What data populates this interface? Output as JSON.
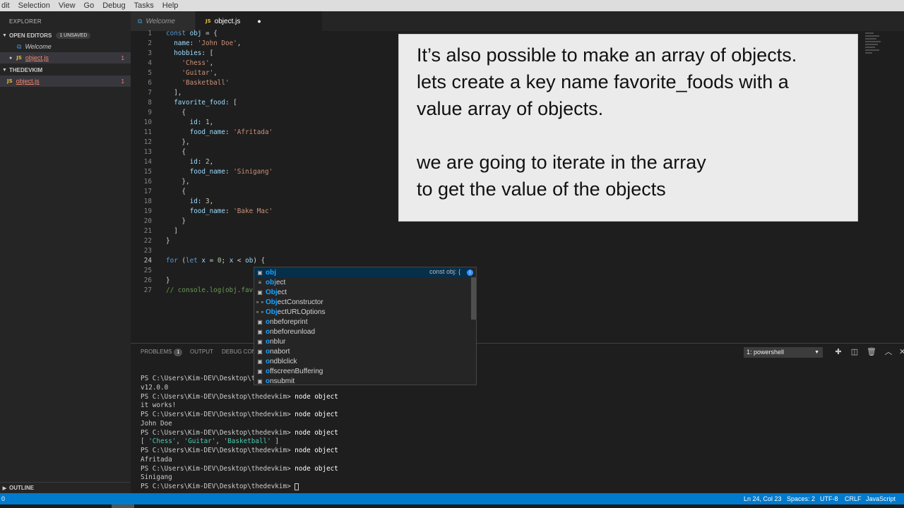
{
  "menubar": {
    "items": [
      "dit",
      "Selection",
      "View",
      "Go",
      "Debug",
      "Tasks",
      "Help"
    ]
  },
  "sidebar": {
    "title": "EXPLORER",
    "open_editors": {
      "label": "OPEN EDITORS",
      "badge": "1 UNSAVED",
      "icon": "chevron-down-icon"
    },
    "open_files": [
      {
        "name": "Welcome",
        "icon": "vscode-icon"
      },
      {
        "name": "object.js",
        "icon": "js-icon",
        "count": "1"
      }
    ],
    "folder": {
      "label": "THEDEVKIM",
      "icon": "chevron-down-icon"
    },
    "folder_files": [
      {
        "name": "object.js",
        "icon": "js-icon",
        "count": "1"
      }
    ],
    "outline": {
      "label": "OUTLINE",
      "icon": "chevron-right-icon"
    }
  },
  "tabs": [
    {
      "label": "Welcome",
      "icon": "vscode-icon"
    },
    {
      "label": "object.js",
      "icon": "js-icon",
      "dirty": "●"
    }
  ],
  "editor": {
    "lines": [
      {
        "n": "1",
        "html": "<span class='k'>const</span> <span class='p'>obj</span> <span class='t'>= {</span>"
      },
      {
        "n": "2",
        "html": "  <span class='p'>name</span><span class='t'>:</span> <span class='s'>'John Doe'</span><span class='t'>,</span>"
      },
      {
        "n": "3",
        "html": "  <span class='p'>hobbies</span><span class='t'>: [</span>"
      },
      {
        "n": "4",
        "html": "    <span class='s'>'Chess'</span><span class='t'>,</span>"
      },
      {
        "n": "5",
        "html": "    <span class='s'>'Guitar'</span><span class='t'>,</span>"
      },
      {
        "n": "6",
        "html": "    <span class='s'>'Basketball'</span>"
      },
      {
        "n": "7",
        "html": "  <span class='t'>],</span>"
      },
      {
        "n": "8",
        "html": "  <span class='p'>favorite_food</span><span class='t'>: [</span>"
      },
      {
        "n": "9",
        "html": "    <span class='t'>{</span>"
      },
      {
        "n": "10",
        "html": "      <span class='p'>id</span><span class='t'>:</span> <span class='n'>1</span><span class='t'>,</span>"
      },
      {
        "n": "11",
        "html": "      <span class='p'>food_name</span><span class='t'>:</span> <span class='s'>'Afritada'</span>"
      },
      {
        "n": "12",
        "html": "    <span class='t'>},</span>"
      },
      {
        "n": "13",
        "html": "    <span class='t'>{</span>"
      },
      {
        "n": "14",
        "html": "      <span class='p'>id</span><span class='t'>:</span> <span class='n'>2</span><span class='t'>,</span>"
      },
      {
        "n": "15",
        "html": "      <span class='p'>food_name</span><span class='t'>:</span> <span class='s'>'Sinigang'</span>"
      },
      {
        "n": "16",
        "html": "    <span class='t'>},</span>"
      },
      {
        "n": "17",
        "html": "    <span class='t'>{</span>"
      },
      {
        "n": "18",
        "html": "      <span class='p'>id</span><span class='t'>:</span> <span class='n'>3</span><span class='t'>,</span>"
      },
      {
        "n": "19",
        "html": "      <span class='p'>food_name</span><span class='t'>:</span> <span class='s'>'Bake Mac'</span>"
      },
      {
        "n": "20",
        "html": "    <span class='t'>}</span>"
      },
      {
        "n": "21",
        "html": "  <span class='t'>]</span>"
      },
      {
        "n": "22",
        "html": "<span class='t'>}</span>"
      },
      {
        "n": "23",
        "html": ""
      },
      {
        "n": "24",
        "html": "<span class='k'>for</span> <span class='t'>(</span><span class='k'>let</span> <span class='p'>x</span> <span class='t'>=</span> <span class='n'>0</span><span class='t'>;</span> <span class='p'>x</span> <span class='t'>&lt;</span> <span class='p'>ob</span><span class='t'>)</span> <span class='t'>{</span>",
        "active": true
      },
      {
        "n": "25",
        "html": ""
      },
      {
        "n": "26",
        "html": "<span class='t'>}</span>"
      },
      {
        "n": "27",
        "html": "<span class='c'>// console.log(obj.fav</span>"
      }
    ]
  },
  "callout": {
    "para1": [
      "It’s also possible to make an array of objects.",
      "lets create a key name favorite_foods with a",
      "value array of objects."
    ],
    "para2": [
      "we are going to iterate in the array",
      "to get the value of the objects"
    ]
  },
  "suggest": {
    "detail": "const obj: {",
    "items": [
      {
        "icon": "▣",
        "pre": "",
        "hl": "obj",
        "post": ""
      },
      {
        "icon": "≡",
        "pre": "",
        "hl": "obj",
        "post": "ect"
      },
      {
        "icon": "▣",
        "pre": "",
        "hl": "Obj",
        "post": "ect"
      },
      {
        "icon": "⚬⚬",
        "pre": "",
        "hl": "Obj",
        "post": "ectConstructor"
      },
      {
        "icon": "⚬⚬",
        "pre": "",
        "hl": "Obj",
        "post": "ectURLOptions"
      },
      {
        "icon": "▣",
        "pre": "",
        "hl": "o",
        "post": "nbeforeprint",
        "hl2": "b"
      },
      {
        "icon": "▣",
        "pre": "",
        "hl": "o",
        "post": "nbeforeunload"
      },
      {
        "icon": "▣",
        "pre": "",
        "hl": "o",
        "post": "nblur"
      },
      {
        "icon": "▣",
        "pre": "",
        "hl": "o",
        "post": "nabort"
      },
      {
        "icon": "▣",
        "pre": "",
        "hl": "o",
        "post": "ndblclick"
      },
      {
        "icon": "▣",
        "pre": "",
        "hl": "o",
        "post": "ffscreenBuffering"
      },
      {
        "icon": "▣",
        "pre": "",
        "hl": "o",
        "post": "nsubmit"
      }
    ]
  },
  "panel": {
    "tabs": [
      {
        "label": "PROBLEMS",
        "badge": "1"
      },
      {
        "label": "OUTPUT"
      },
      {
        "label": "DEBUG CON"
      }
    ],
    "terminal_select": "1: powershell",
    "icons": [
      "plus-icon",
      "split-icon",
      "trash-icon",
      "chevron-up-icon"
    ]
  },
  "terminal": {
    "lines": [
      {
        "prompt": "PS C:\\Users\\Kim-DEV\\Desktop\\t",
        "cmd": ""
      },
      {
        "text": "v12.0.0"
      },
      {
        "prompt": "PS C:\\Users\\Kim-DEV\\Desktop\\thedevkim> ",
        "cmd": "node object"
      },
      {
        "text": "it works!"
      },
      {
        "prompt": "PS C:\\Users\\Kim-DEV\\Desktop\\thedevkim> ",
        "cmd": "node object"
      },
      {
        "text": "John Doe"
      },
      {
        "prompt": "PS C:\\Users\\Kim-DEV\\Desktop\\thedevkim> ",
        "cmd": "node object"
      },
      {
        "array": [
          "'Chess'",
          "'Guitar'",
          "'Basketball'"
        ]
      },
      {
        "prompt": "PS C:\\Users\\Kim-DEV\\Desktop\\thedevkim> ",
        "cmd": "node object"
      },
      {
        "text": "Afritada"
      },
      {
        "prompt": "PS C:\\Users\\Kim-DEV\\Desktop\\thedevkim> ",
        "cmd": "node object"
      },
      {
        "text": "Sinigang"
      },
      {
        "prompt": "PS C:\\Users\\Kim-DEV\\Desktop\\thedevkim> ",
        "cmd": "",
        "cursor": true
      }
    ]
  },
  "statusbar": {
    "left": "0",
    "position": "Ln 24, Col 23",
    "spaces": "Spaces: 2",
    "encoding": "UTF-8",
    "eol": "CRLF",
    "language": "JavaScript"
  },
  "colors": {
    "accent": "#007acc",
    "error": "#f48771",
    "highlight": "#18a3ff"
  }
}
